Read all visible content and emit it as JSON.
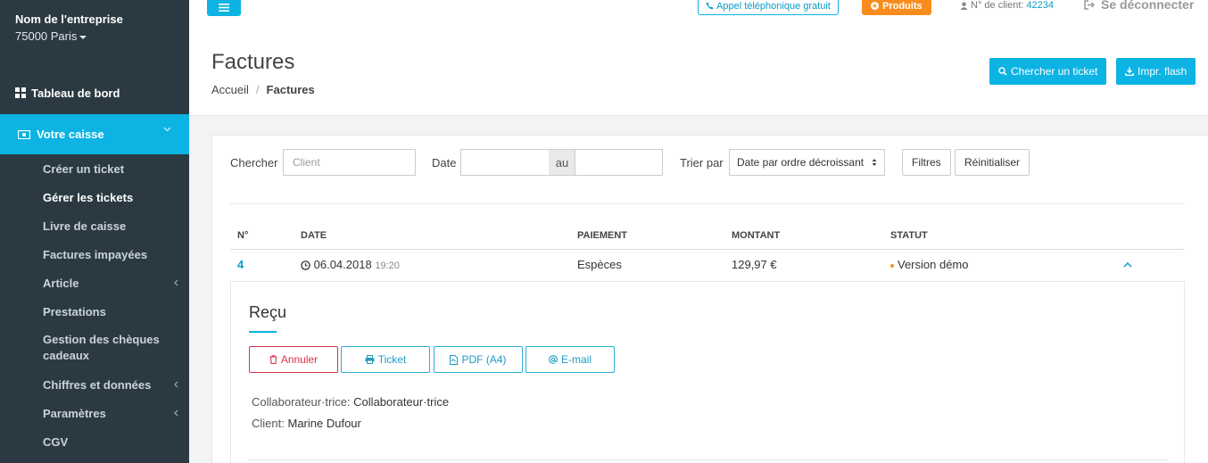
{
  "sidebar": {
    "company_name": "Nom de l'entreprise",
    "company_city": "75000 Paris",
    "dashboard_label": "Tableau de bord",
    "active_section": "Votre caisse",
    "items": [
      {
        "label": "Créer un ticket"
      },
      {
        "label": "Gérer les tickets"
      },
      {
        "label": "Livre de caisse"
      },
      {
        "label": "Factures impayées"
      },
      {
        "label": "Article"
      },
      {
        "label": "Prestations"
      },
      {
        "label": "Gestion des chèques cadeaux"
      },
      {
        "label": "Chiffres et données"
      },
      {
        "label": "Paramètres"
      },
      {
        "label": "CGV"
      }
    ]
  },
  "topbar": {
    "call_label": "Appel téléphonique gratuit",
    "products_label": "Produits",
    "client_prefix": "N° de client:",
    "client_number": "42234",
    "logout_label": "Se déconnecter"
  },
  "header": {
    "title": "Factures",
    "breadcrumb_home": "Accueil",
    "breadcrumb_sep": "/",
    "breadcrumb_current": "Factures",
    "search_ticket_label": "Chercher un ticket",
    "print_flash_label": "Impr. flash"
  },
  "filters": {
    "search_label": "Chercher",
    "client_placeholder": "Client",
    "date_label": "Date",
    "date_to": "au",
    "sort_label": "Trier par",
    "sort_value": "Date par ordre décroissant",
    "filters_button": "Filtres",
    "reset_button": "Réinitialiser"
  },
  "table": {
    "columns": [
      "N°",
      "DATE",
      "PAIEMENT",
      "MONTANT",
      "STATUT"
    ],
    "rows": [
      {
        "number": "4",
        "date": "06.04.2018",
        "time": "19:20",
        "payment": "Espèces",
        "amount": "129,97 €",
        "status": "Version démo"
      }
    ]
  },
  "detail": {
    "title": "Reçu",
    "cancel_label": "Annuler",
    "ticket_label": "Ticket",
    "pdf_label": "PDF (A4)",
    "email_label": "E-mail",
    "collaborator_label": "Collaborateur·trice:",
    "collaborator_value": "Collaborateur·trice",
    "client_label": "Client:",
    "client_value": "Marine Dufour"
  },
  "colors": {
    "accent": "#0cb3e3",
    "sidebar_bg": "#2b3a42",
    "orange": "#f88d1d",
    "danger": "#d9334a"
  }
}
